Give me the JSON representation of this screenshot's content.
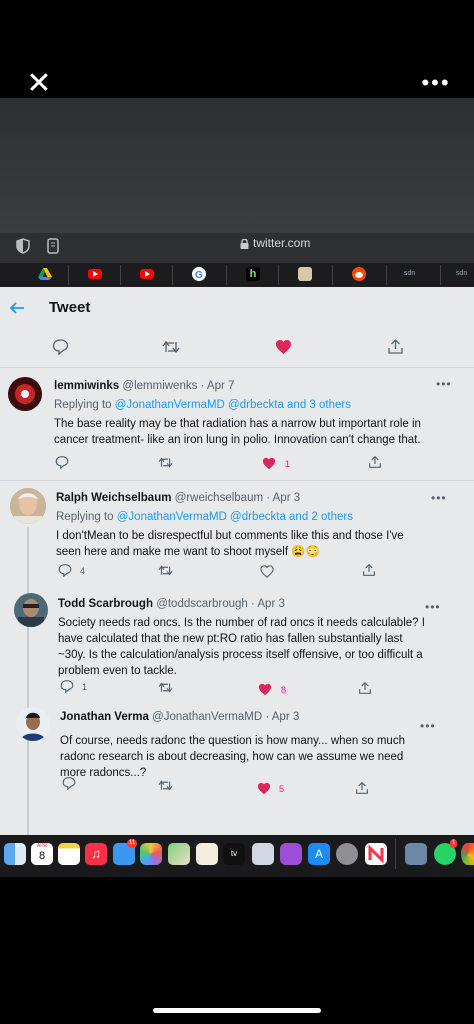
{
  "viewer": {
    "close_icon": "close-icon",
    "more_icon": "more-icon",
    "more_glyph": "•••",
    "close_glyph": "✕"
  },
  "browser": {
    "url": "twitter.com"
  },
  "bookmarks": [
    "drive",
    "youtube",
    "youtube",
    "google",
    "hulu",
    "news",
    "reddit",
    "sdn",
    "sdn"
  ],
  "bookmark_text": {
    "hulu": "h",
    "sdn1": "sdn",
    "sdn2": "sdn"
  },
  "header": {
    "title": "Tweet",
    "back_icon": "arrow-left-icon"
  },
  "tweets": [
    {
      "name": "lemmiwinks",
      "handle": "@lemmiwenks",
      "date": "· Apr 7",
      "reply_prefix": "Replying to",
      "reply_to": "@JonathanVermaMD @drbeckta and 3 others",
      "text": "The base reality may be that radiation has a narrow but important role in cancer treatment- like an iron lung in polio. Innovation can't change that.",
      "replies": "",
      "likes": "1",
      "liked": true
    },
    {
      "name": "Ralph Weichselbaum",
      "handle": "@rweichselbaum",
      "date": "· Apr 3",
      "reply_prefix": "Replying to",
      "reply_to": "@JonathanVermaMD @drbeckta and 2 others",
      "text": "I don'tMean to be disrespectful but comments like this and those I've seen here and make me want to  shoot myself 😩😳",
      "replies": "4",
      "likes": "",
      "liked": false
    },
    {
      "name": "Todd Scarbrough",
      "handle": "@toddscarbrough",
      "date": "· Apr 3",
      "text": "Society needs rad oncs. Is the number of rad oncs it needs calculable? I have calculated that the new pt:RO ratio has fallen substantially last ~30y. Is the calculation/analysis process itself offensive, or too difficult a problem even to tackle.",
      "replies": "1",
      "likes": "8",
      "liked": true
    },
    {
      "name": "Jonathan Verma",
      "handle": "@JonathanVermaMD",
      "date": "· Apr 3",
      "text": "Of course, needs radonc the question is how many... when so much radonc research is about decreasing, how can we assume we need more radoncs...?",
      "replies": "",
      "likes": "5",
      "liked": true
    }
  ],
  "dock": {
    "calendar_month": "APR",
    "calendar_day": "8",
    "mail_badge": "11",
    "whatsapp_badge": "1",
    "appletv_label": "tv"
  },
  "colors": {
    "heart": "#f91880",
    "link": "#1d9bf0",
    "screen_bg": "#e8e9eb"
  }
}
